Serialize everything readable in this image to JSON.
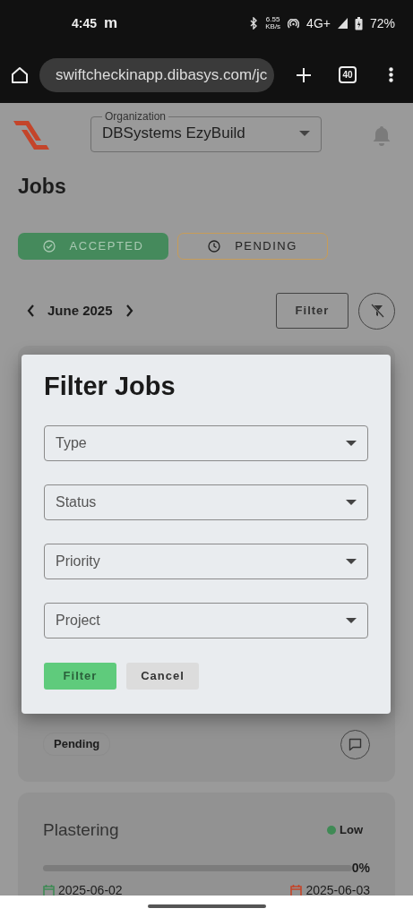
{
  "status_bar": {
    "time": "4:45",
    "carrier": "m",
    "net_speed": "6.55",
    "net_speed_unit": "KB/s",
    "network": "4G+",
    "battery": "72%"
  },
  "browser": {
    "url": "swiftcheckinapp.dibasys.com/jc",
    "tab_count": "40"
  },
  "header": {
    "organization_label": "Organization",
    "organization": "DBSystems EzyBuild"
  },
  "title": "Jobs",
  "tabs": [
    {
      "label": "ACCEPTED",
      "selected": true,
      "kind": "accepted"
    },
    {
      "label": "PENDING",
      "selected": false,
      "kind": "pending"
    }
  ],
  "month": "June 2025",
  "filter_button": "Filter",
  "jobs": [
    {
      "status": "Pending"
    },
    {
      "title": "Plastering",
      "priority": "Low",
      "color": "#3f8a55",
      "level": 0,
      "progress": "0%",
      "start_date": "2025-06-02",
      "end_date": "2025-06-03"
    }
  ],
  "modal": {
    "title": "Filter Jobs",
    "fields": [
      {
        "placeholder": "Type"
      },
      {
        "placeholder": "Status"
      },
      {
        "placeholder": "Priority"
      },
      {
        "placeholder": "Project"
      }
    ],
    "buttons": [
      {
        "label": "Filter",
        "kind": "primary"
      },
      {
        "label": "Cancel",
        "kind": "secondary"
      }
    ]
  }
}
